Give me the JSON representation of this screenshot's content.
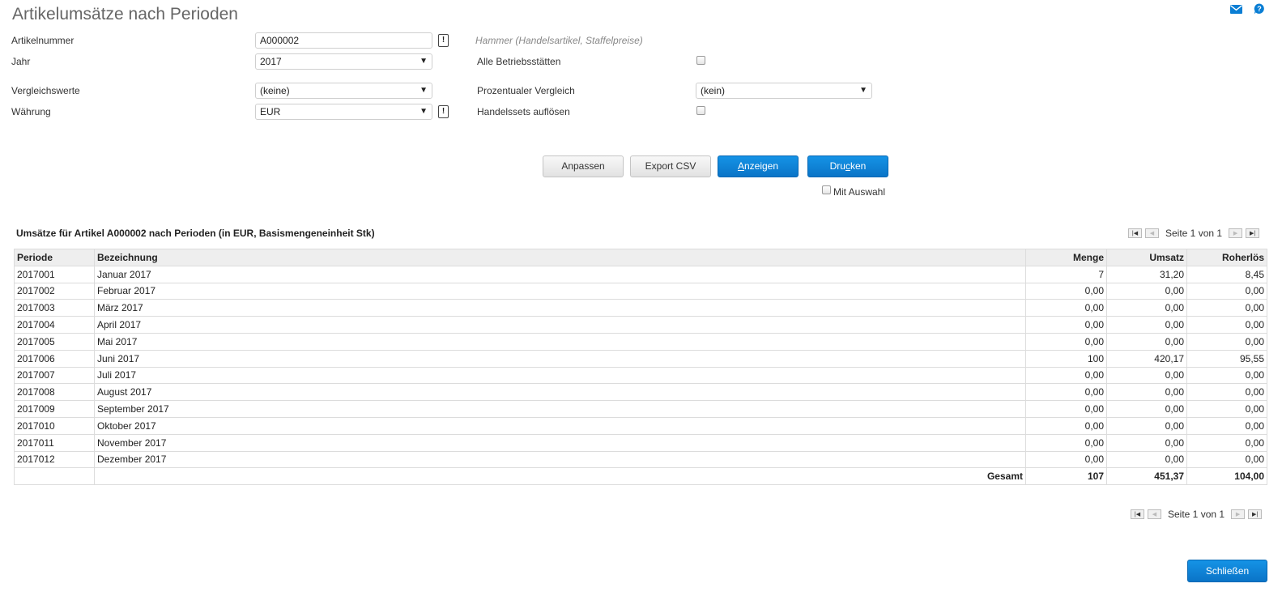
{
  "page": {
    "title": "Artikelumsätze nach Perioden"
  },
  "header_icons": {
    "mail": "mail-icon",
    "help": "help-icon"
  },
  "form": {
    "artikelnummer_label": "Artikelnummer",
    "artikelnummer_value": "A000002",
    "artikel_hint": "Hammer (Handelsartikel, Staffelpreise)",
    "jahr_label": "Jahr",
    "jahr_value": "2017",
    "alle_betriebsstaetten_label": "Alle Betriebsstätten",
    "vergleichswerte_label": "Vergleichswerte",
    "vergleichswerte_value": "(keine)",
    "prozentualer_vergleich_label": "Prozentualer Vergleich",
    "prozentualer_vergleich_value": "(kein)",
    "waehrung_label": "Währung",
    "waehrung_value": "EUR",
    "handelssets_label": "Handelssets auflösen",
    "exclamation": "!",
    "caret": "▼"
  },
  "buttons": {
    "anpassen": "Anpassen",
    "export_csv": "Export CSV",
    "anzeigen_u": "A",
    "anzeigen_rest": "nzeigen",
    "drucken_pre": "Dru",
    "drucken_u": "c",
    "drucken_post": "ken",
    "mit_auswahl": "Mit Auswahl",
    "schliessen": "Schließen"
  },
  "table": {
    "title": "Umsätze für Artikel A000002 nach Perioden (in EUR, Basismengeneinheit Stk)",
    "pager_text": "Seite 1 von 1",
    "columns": [
      "Periode",
      "Bezeichnung",
      "Menge",
      "Umsatz",
      "Roherlös"
    ],
    "rows": [
      [
        "2017001",
        "Januar 2017",
        "7",
        "31,20",
        "8,45"
      ],
      [
        "2017002",
        "Februar 2017",
        "0,00",
        "0,00",
        "0,00"
      ],
      [
        "2017003",
        "März 2017",
        "0,00",
        "0,00",
        "0,00"
      ],
      [
        "2017004",
        "April 2017",
        "0,00",
        "0,00",
        "0,00"
      ],
      [
        "2017005",
        "Mai 2017",
        "0,00",
        "0,00",
        "0,00"
      ],
      [
        "2017006",
        "Juni 2017",
        "100",
        "420,17",
        "95,55"
      ],
      [
        "2017007",
        "Juli 2017",
        "0,00",
        "0,00",
        "0,00"
      ],
      [
        "2017008",
        "August 2017",
        "0,00",
        "0,00",
        "0,00"
      ],
      [
        "2017009",
        "September 2017",
        "0,00",
        "0,00",
        "0,00"
      ],
      [
        "2017010",
        "Oktober 2017",
        "0,00",
        "0,00",
        "0,00"
      ],
      [
        "2017011",
        "November 2017",
        "0,00",
        "0,00",
        "0,00"
      ],
      [
        "2017012",
        "Dezember 2017",
        "0,00",
        "0,00",
        "0,00"
      ]
    ],
    "total": {
      "label": "Gesamt",
      "menge": "107",
      "umsatz": "451,37",
      "roherloes": "104,00"
    }
  },
  "colors": {
    "accent": "#0a7ed4",
    "header_bg": "#eeeeee",
    "border": "#dcdcdc"
  }
}
